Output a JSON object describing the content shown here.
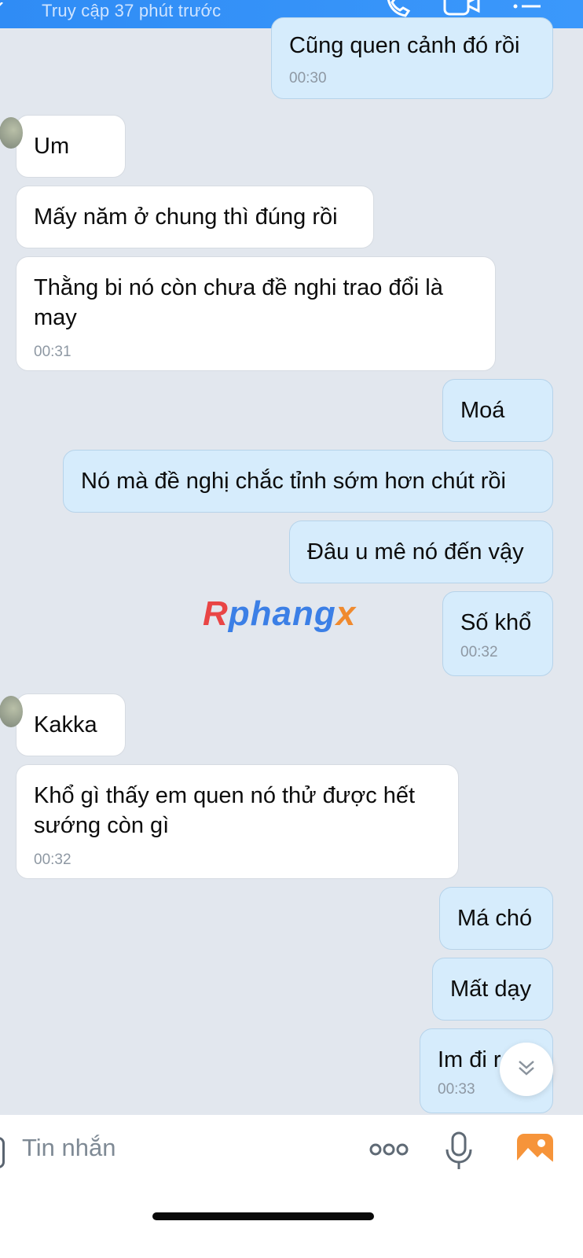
{
  "header": {
    "status_text": "Truy cập 37 phút trước"
  },
  "messages": [
    {
      "side": "out",
      "text": "Cũng quen cảnh đó rồi",
      "time": "00:30"
    },
    {
      "side": "in",
      "text": "Um",
      "time": ""
    },
    {
      "side": "in",
      "text": "Mấy năm ở chung thì đúng rồi",
      "time": ""
    },
    {
      "side": "in",
      "text": "Thằng bi nó còn chưa đề nghi trao đổi là may",
      "time": "00:31"
    },
    {
      "side": "out",
      "text": "Moá",
      "time": ""
    },
    {
      "side": "out",
      "text": "Nó mà đề nghị chắc tỉnh sớm hơn chút rồi",
      "time": ""
    },
    {
      "side": "out",
      "text": "Đâu u mê nó đến vậy",
      "time": ""
    },
    {
      "side": "out",
      "text": "Số khổ",
      "time": "00:32"
    },
    {
      "side": "in",
      "text": "Kakka",
      "time": ""
    },
    {
      "side": "in",
      "text": "Khổ gì thấy em quen nó thử được hết sướng còn gì",
      "time": "00:32"
    },
    {
      "side": "out",
      "text": "Má chó",
      "time": ""
    },
    {
      "side": "out",
      "text": "Mất dạy",
      "time": ""
    },
    {
      "side": "out",
      "text": "Im đi r",
      "time": "00:33"
    }
  ],
  "watermark": {
    "part1": "R",
    "part2": "phang",
    "part3": "x"
  },
  "composer": {
    "placeholder": "Tin nhắn"
  },
  "icons": {
    "header": [
      "phone-icon",
      "video-call-icon",
      "menu-list-icon"
    ],
    "composer": [
      "more-options-icon",
      "microphone-icon",
      "image-gallery-icon"
    ],
    "scroll": "chevron-double-down-icon"
  },
  "colors": {
    "header": "#2f8cf5",
    "outgoing_bubble": "#d6ecfc",
    "incoming_bubble": "#ffffff",
    "background": "#e2e7ee",
    "gallery_icon": "#f6943a"
  }
}
